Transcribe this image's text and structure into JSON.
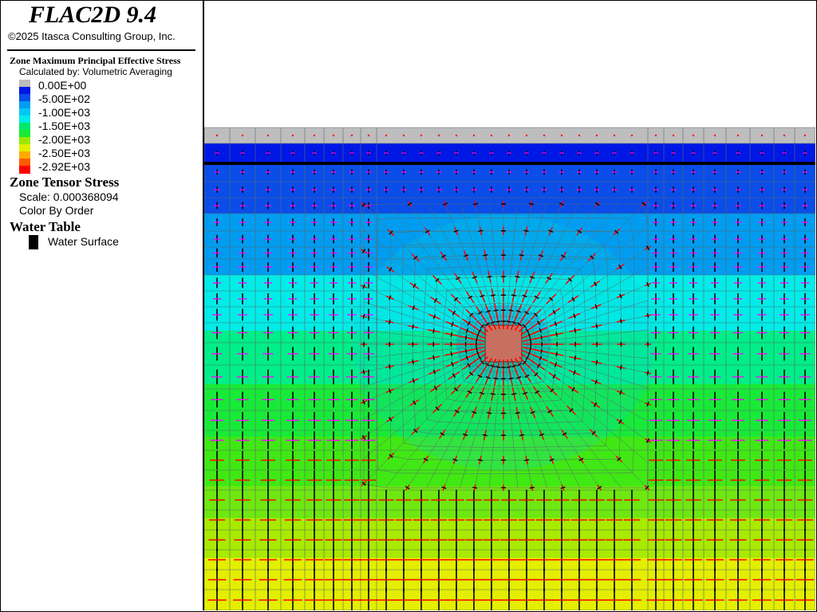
{
  "app": {
    "title": "FLAC2D 9.4",
    "copyright": "©2025 Itasca Consulting Group, Inc."
  },
  "contour": {
    "title": "Zone Maximum Principal Effective Stress",
    "subtitle": "Calculated by: Volumetric Averaging",
    "levels": [
      {
        "label": "0.00E+00",
        "color": "#bdbdbd"
      },
      {
        "label": "-5.00E+02",
        "color": "#0018e6"
      },
      {
        "label": "-1.00E+03",
        "color": "#009cf0"
      },
      {
        "label": "-1.50E+03",
        "color": "#00ece8"
      },
      {
        "label": "-2.00E+03",
        "color": "#00e96a"
      },
      {
        "label": "-2.50E+03",
        "color": "#e3ee00"
      },
      {
        "label": "-2.92E+03",
        "color": "#ff0000"
      }
    ],
    "extra_swatch_colors": [
      "#0a4de8",
      "#00c8f4",
      "#18ea38",
      "#9ae800",
      "#ffab00",
      "#ff5a00"
    ]
  },
  "tensor": {
    "title": "Zone Tensor Stress",
    "scale": "Scale: 0.000368094",
    "color_mode": "Color By Order"
  },
  "water": {
    "title": "Water Table",
    "item": "Water Surface"
  },
  "colors": {
    "major": "#ff0000",
    "minor": "#ff00ff",
    "water": "#000000",
    "mesh": "#5b6a6a"
  }
}
